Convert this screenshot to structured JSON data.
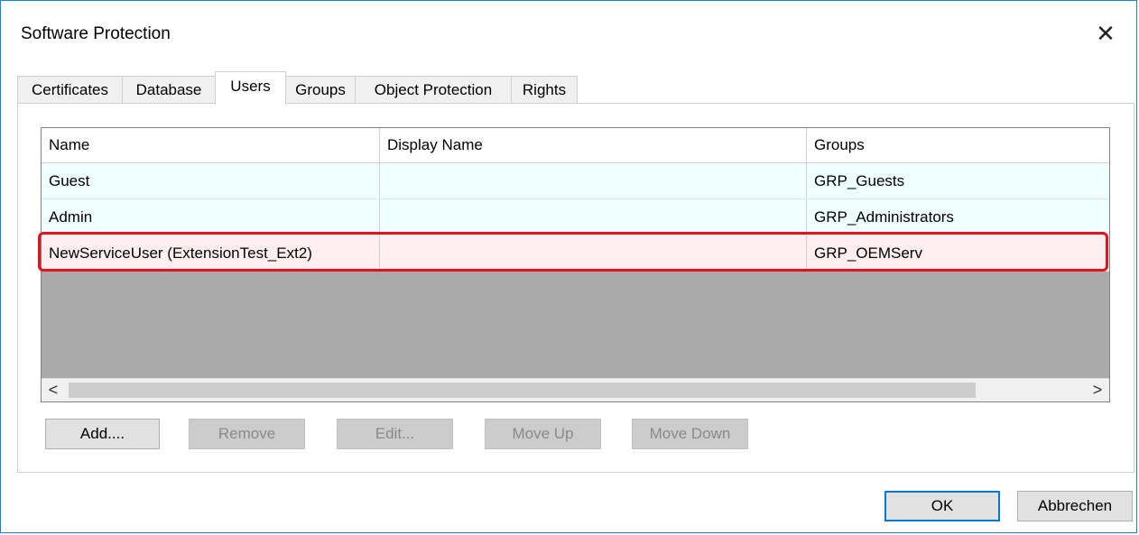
{
  "window": {
    "title": "Software Protection",
    "close_glyph": "✕"
  },
  "tabs": [
    {
      "label": "Certificates"
    },
    {
      "label": "Database"
    },
    {
      "label": "Users",
      "active": true
    },
    {
      "label": "Groups"
    },
    {
      "label": "Object Protection"
    },
    {
      "label": "Rights"
    }
  ],
  "users_table": {
    "columns": [
      "Name",
      "Display Name",
      "Groups"
    ],
    "rows": [
      {
        "name": "Guest",
        "display_name": "",
        "groups": "GRP_Guests"
      },
      {
        "name": "Admin",
        "display_name": "",
        "groups": "GRP_Administrators"
      },
      {
        "name": "NewServiceUser (ExtensionTest_Ext2)",
        "display_name": "",
        "groups": "GRP_OEMServ",
        "highlighted": true
      }
    ],
    "scroll_left_glyph": "<",
    "scroll_right_glyph": ">"
  },
  "buttons": {
    "add": "Add....",
    "remove": "Remove",
    "edit": "Edit...",
    "move_up": "Move Up",
    "move_down": "Move Down",
    "ok": "OK",
    "cancel": "Abbrechen"
  },
  "colors": {
    "window_border": "#1883d7",
    "row_bg": "#f0ffff",
    "highlight_border": "#e0141e",
    "default_button_border": "#0078d7"
  }
}
